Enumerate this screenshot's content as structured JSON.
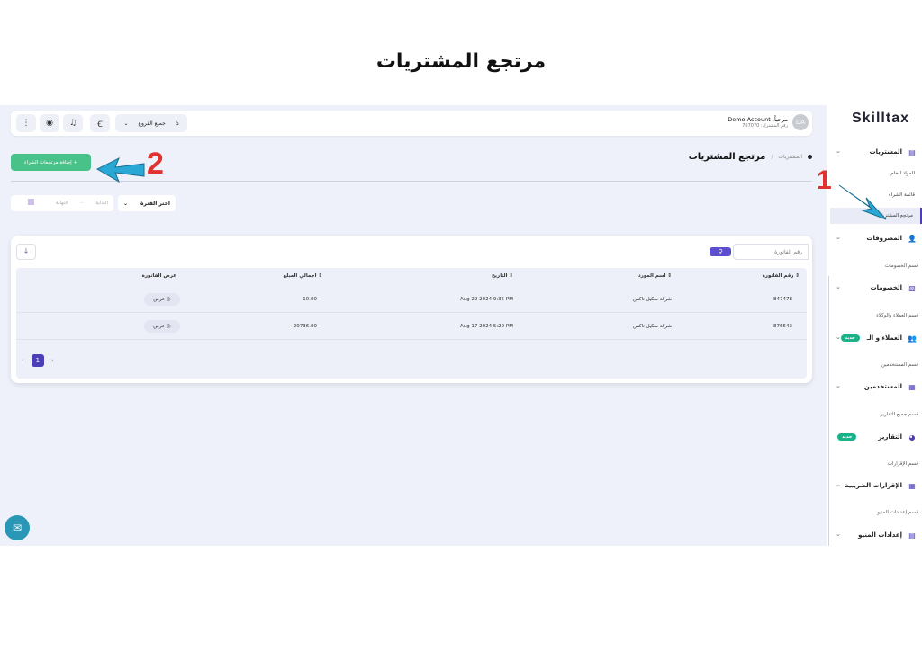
{
  "heading": "مرتجع المشتريات",
  "logo": "Skilltax",
  "sidebar": {
    "purchases": {
      "label": "المشتريات"
    },
    "raw_materials": "المواد الخام",
    "purchase_list": "قائمة الشراء",
    "purchase_returns": "مرتجع المشتريات",
    "expenses": {
      "label": "المصروفات"
    },
    "discounts_caption": "قسم الخصومات",
    "discounts": {
      "label": "الخصومات"
    },
    "customers_caption": "قسم العملاء والوكلاء",
    "customers": {
      "label": "العملاء و الـ",
      "badge": "جديد"
    },
    "users_caption": "قسم المستخدمين",
    "users": {
      "label": "المستخدمين"
    },
    "reports_caption": "قسم جميع التقارير",
    "reports": {
      "label": "التقارير",
      "badge": "جديد"
    },
    "tax_caption": "قسم الإقرارات",
    "tax": {
      "label": "الإقرارات الضريبية"
    },
    "menu_caption": "قسم إعدادات المنيو",
    "menu_settings": {
      "label": "إعدادات المنيو"
    }
  },
  "topbar": {
    "branch_label": "جميع الفروع",
    "user_greeting": "مرحباً, Demo Account",
    "user_sub": "رقم المشترك: 707070",
    "avatar_initials": "DA"
  },
  "breadcrumb": {
    "parent": "المشتريات",
    "separator": "/",
    "current": "مرتجع المشتريات"
  },
  "add_button": "+ إضافة مرتجعات الشراء",
  "filter": {
    "period_label": "اختر الفترة",
    "start_placeholder": "البداية",
    "end_placeholder": "النهاية",
    "dash": "–"
  },
  "search": {
    "placeholder": "رقم الفاتورة"
  },
  "table": {
    "columns": [
      "رقم الفاتورة",
      "اسم المورد",
      "التاريخ",
      "اجمالي المبلغ",
      "عرض الفاتورة"
    ],
    "rows": [
      {
        "invoice": "847478",
        "supplier": "شركة سكيل تاكس",
        "date": "Aug 29 2024 9:35 PM",
        "amount": "-10.00",
        "view": "عرض"
      },
      {
        "invoice": "876543",
        "supplier": "شركة سكيل تاكس",
        "date": "Aug 17 2024 5:29 PM",
        "amount": "-20736.00",
        "view": "عرض"
      }
    ]
  },
  "pagination": {
    "current_page": "1",
    "prev": "‹",
    "next": "›"
  },
  "annotations": {
    "one": "1",
    "two": "2"
  },
  "colors": {
    "accent": "#4b3fb8",
    "green": "#49c28a",
    "arrow": "#29a8d6",
    "annotation": "#e0322f"
  }
}
